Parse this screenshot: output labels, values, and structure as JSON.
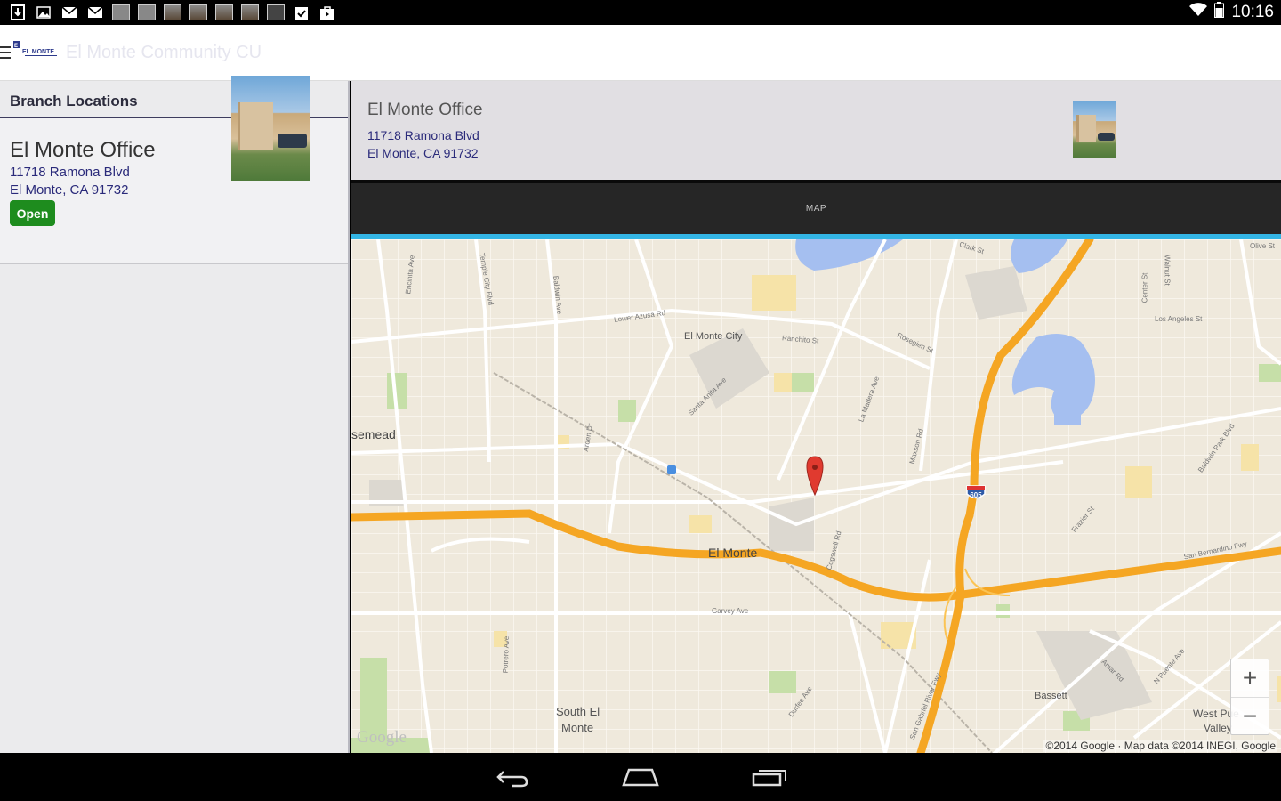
{
  "status_bar": {
    "time": "10:16",
    "notification_icons": [
      "download-icon",
      "image-icon",
      "mail-icon",
      "mail-icon",
      "app-thumbnail-icon",
      "app-thumbnail-icon",
      "photo-thumbnail-icon",
      "photo-thumbnail-icon",
      "photo-thumbnail-icon",
      "photo-thumbnail-icon",
      "app-thumbnail-icon",
      "clipboard-check-icon",
      "shopping-bag-icon"
    ]
  },
  "action_bar": {
    "logo_text": "EL MONTE",
    "title": "El Monte Community CU"
  },
  "sidebar": {
    "header": "Branch Locations",
    "branches": [
      {
        "name": "El Monte Office",
        "address_line1": "11718 Ramona Blvd",
        "address_line2": "El Monte, CA  91732",
        "status": "Open"
      }
    ]
  },
  "detail": {
    "name": "El Monte Office",
    "address_line1": "11718 Ramona Blvd",
    "address_line2": "El Monte, CA  91732"
  },
  "tabs": [
    {
      "label": "MAP"
    }
  ],
  "map": {
    "places": {
      "el_monte": "El Monte",
      "el_monte_city": "El Monte City",
      "rosemead": "semead",
      "south_el_monte_1": "South El",
      "south_el_monte_2": "Monte",
      "bassett": "Bassett",
      "west_puente_1": "West Pue",
      "west_puente_2": "Valley"
    },
    "streets": {
      "lower_azusa": "Lower Azusa Rd",
      "ranchito": "Ranchito St",
      "rosegien": "Rosegien St",
      "clark": "Clark St",
      "olive": "Olive St",
      "los_angeles": "Los Angeles St",
      "garvey": "Garvey Ave",
      "santa_anita": "Santa Anita Ave",
      "temple_city": "Temple City Blvd",
      "baldwin": "Baldwin Ave",
      "encinita": "Encinita Ave",
      "arden": "Arden Dr",
      "la_madera": "La Madera Ave",
      "maxson": "Maxson Rd",
      "cogswell": "Cogswell Rd",
      "durfee": "Durfee Ave",
      "potrero": "Potrero Ave",
      "frazier": "Frazier St",
      "baldwin_park": "Baldwin Park Blvd",
      "san_bernardino": "San Bernardino Fwy",
      "amar": "Amar Rd",
      "n_puente": "N Puente Ave",
      "san_gabriel": "San Gabriel River Fwy",
      "walnut": "Walnut St",
      "center": "Center St"
    },
    "shield_605": "605",
    "zoom_in": "+",
    "zoom_out": "−",
    "google_logo": "Google",
    "copyright": "©2014 Google · Map data ©2014 INEGI, Google"
  },
  "colors": {
    "accent": "#33b5e5",
    "open_badge": "#1e8c1e",
    "header_rule": "#3d3c5e",
    "address": "#2a2a7a",
    "freeway": "#f5a623",
    "marker": "#e03a2f"
  }
}
